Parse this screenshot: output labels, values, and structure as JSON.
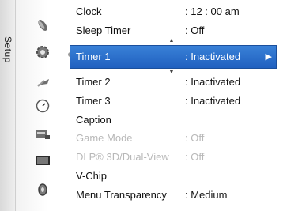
{
  "sidebar": {
    "tab_label": "Setup",
    "icons": [
      "satellite-dish-icon",
      "gear-icon",
      "antenna-icon",
      "clock-icon",
      "input-icon",
      "picture-icon",
      "speaker-icon"
    ]
  },
  "menu": {
    "items": [
      {
        "label": "Clock",
        "value": ": 12 : 00 am",
        "state": "normal"
      },
      {
        "label": "Sleep Timer",
        "value": ": Off",
        "state": "normal"
      },
      {
        "label": "Timer 1",
        "value": ": Inactivated",
        "state": "selected"
      },
      {
        "label": "Timer 2",
        "value": ": Inactivated",
        "state": "normal"
      },
      {
        "label": "Timer 3",
        "value": ": Inactivated",
        "state": "normal"
      },
      {
        "label": "Caption",
        "value": "",
        "state": "normal"
      },
      {
        "label": "Game Mode",
        "value": ": Off",
        "state": "disabled"
      },
      {
        "label": "DLP® 3D/Dual-View",
        "value": ": Off",
        "state": "disabled"
      },
      {
        "label": "V-Chip",
        "value": "",
        "state": "normal"
      },
      {
        "label": "Menu Transparency",
        "value": ": Medium",
        "state": "normal"
      }
    ],
    "selected_arrow": "▶",
    "scroll_up": "▲",
    "scroll_down": "▼"
  },
  "colors": {
    "selection": "#2a6fcc",
    "disabled_text": "#b8b8b8",
    "text": "#111111"
  }
}
